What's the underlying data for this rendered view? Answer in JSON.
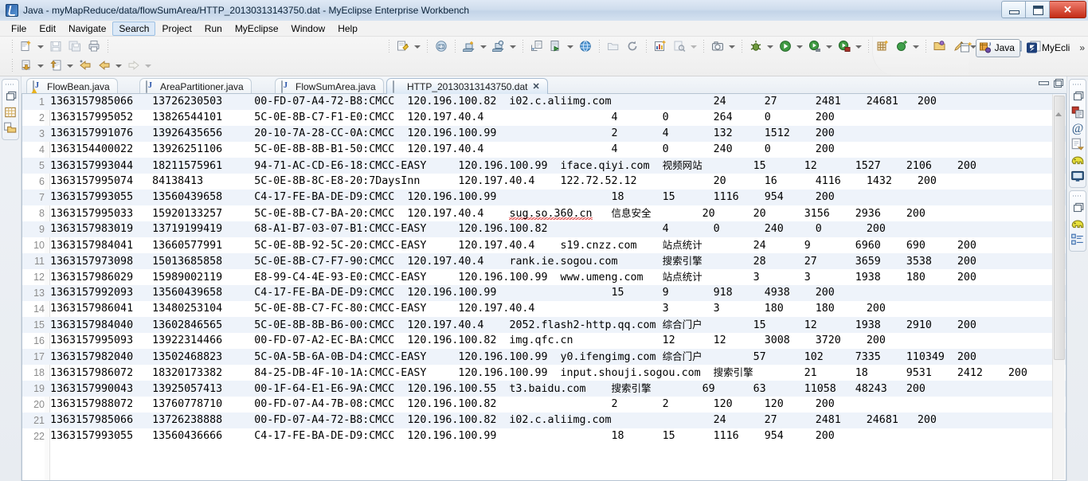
{
  "window": {
    "title": "Java - myMapReduce/data/flowSumArea/HTTP_20130313143750.dat - MyEclipse Enterprise Workbench",
    "app_icon": "myeclipse-icon",
    "controls": [
      {
        "name": "minimize-button",
        "glyph": "minimize-icon"
      },
      {
        "name": "restore-button",
        "glyph": "restore-icon"
      },
      {
        "name": "close-button",
        "glyph": "close-icon"
      }
    ]
  },
  "menubar": {
    "items": [
      {
        "label": "File",
        "selected": false
      },
      {
        "label": "Edit",
        "selected": false
      },
      {
        "label": "Navigate",
        "selected": false
      },
      {
        "label": "Search",
        "selected": true
      },
      {
        "label": "Project",
        "selected": false
      },
      {
        "label": "Run",
        "selected": false
      },
      {
        "label": "MyEclipse",
        "selected": false
      },
      {
        "label": "Window",
        "selected": false
      },
      {
        "label": "Help",
        "selected": false
      }
    ]
  },
  "toolbar": {
    "row1": [
      {
        "name": "new-wizard-button",
        "icon": "new-file-icon",
        "dropdown": true
      },
      {
        "name": "save-button",
        "icon": "save-disk-icon",
        "dropdown": false,
        "disabled": true
      },
      {
        "name": "save-all-button",
        "icon": "save-all-icon",
        "dropdown": false,
        "disabled": true
      },
      {
        "name": "print-button",
        "icon": "printer-icon",
        "dropdown": false
      },
      {
        "name": "deploy-button",
        "icon": "deploy-icon",
        "dropdown": true
      },
      {
        "name": "web-browser-button",
        "icon": "browser-2.0-icon",
        "dropdown": false
      },
      {
        "name": "new-server-button",
        "icon": "server-add-icon",
        "dropdown": true
      },
      {
        "name": "manage-server-button",
        "icon": "server-manage-icon",
        "dropdown": true
      },
      {
        "name": "import-button",
        "icon": "import-icon",
        "dropdown": false
      },
      {
        "name": "export-run-button",
        "icon": "export-run-icon",
        "dropdown": true
      },
      {
        "name": "open-browser-button",
        "icon": "globe-icon",
        "dropdown": false
      },
      {
        "name": "open-type-button",
        "icon": "open-type-icon",
        "dropdown": false,
        "disabled": true
      },
      {
        "name": "refresh-button",
        "icon": "refresh-icon",
        "dropdown": false
      },
      {
        "name": "new-report-button",
        "icon": "report-new-icon",
        "dropdown": false
      },
      {
        "name": "search-button",
        "icon": "search-page-icon",
        "dropdown": true,
        "disabled": true
      },
      {
        "name": "snapshot-button",
        "icon": "camera-icon",
        "dropdown": true
      },
      {
        "name": "debug-button",
        "icon": "debug-bug-icon",
        "dropdown": true
      },
      {
        "name": "run-button",
        "icon": "run-play-icon",
        "dropdown": true
      },
      {
        "name": "run-history-button",
        "icon": "run-history-icon",
        "dropdown": true
      },
      {
        "name": "run-external-button",
        "icon": "run-external-icon",
        "dropdown": true
      },
      {
        "name": "new-java-package-button",
        "icon": "package-new-icon",
        "dropdown": false
      },
      {
        "name": "new-class-button",
        "icon": "class-new-icon",
        "dropdown": true
      },
      {
        "name": "open-folder-button",
        "icon": "folder-open-icon",
        "dropdown": false
      },
      {
        "name": "attach-button",
        "icon": "pin-icon",
        "dropdown": true
      },
      {
        "name": "folder-yellow-button",
        "icon": "folder-yellow-icon",
        "dropdown": false
      },
      {
        "name": "toggle-block-selection-button",
        "icon": "block-selection-icon",
        "dropdown": false
      },
      {
        "name": "show-whitespace-button",
        "icon": "pilcrow-icon",
        "dropdown": false
      }
    ],
    "row2": [
      {
        "name": "import-project-button",
        "icon": "import-arrow-icon",
        "dropdown": true
      },
      {
        "name": "export-project-button",
        "icon": "export-arrow-icon",
        "dropdown": true
      },
      {
        "name": "back-history-button",
        "icon": "back-star-icon",
        "dropdown": false
      },
      {
        "name": "back-button",
        "icon": "back-arrow-icon",
        "dropdown": true
      },
      {
        "name": "forward-button",
        "icon": "forward-arrow-icon",
        "dropdown": true,
        "disabled": true
      }
    ],
    "perspective": {
      "open_perspective_name": "open-perspective-button",
      "buttons": [
        {
          "name": "perspective-java",
          "label": "Java",
          "active": true,
          "icon": "java-perspective-icon"
        },
        {
          "name": "perspective-myeclipse",
          "label": "MyEcli",
          "active": false,
          "icon": "myeclipse-perspective-icon"
        }
      ],
      "overflow": "»"
    }
  },
  "left_sidebar": {
    "group": {
      "restore_icon": "restore-view-icon",
      "items": [
        {
          "name": "package-explorer-view-icon",
          "icon": "package-explorer-icon"
        },
        {
          "name": "navigator-view-icon",
          "icon": "navigator-folder-icon"
        }
      ]
    }
  },
  "right_sidebar": {
    "groups": [
      {
        "restore_icon": "restore-view-icon",
        "items": [
          {
            "name": "db-browser-view-icon",
            "icon": "db-browser-icon"
          },
          {
            "name": "mail-view-icon",
            "icon": "at-sign-icon"
          },
          {
            "name": "snippets-view-icon",
            "icon": "snippets-icon"
          },
          {
            "name": "hadoop-view-icon",
            "icon": "elephant-icon"
          },
          {
            "name": "console-view-icon",
            "icon": "console-monitor-icon"
          }
        ]
      },
      {
        "restore_icon": "restore-view-icon",
        "items": [
          {
            "name": "hadoop-location-view-icon",
            "icon": "elephant-icon"
          },
          {
            "name": "outline-view-icon",
            "icon": "outline-icon"
          }
        ]
      }
    ]
  },
  "editor": {
    "tabs": [
      {
        "label": "FlowBean.java",
        "icon": "java-file-warning-icon",
        "active": false,
        "closable": false
      },
      {
        "label": "AreaPartitioner.java",
        "icon": "java-file-icon",
        "active": false,
        "closable": false
      },
      {
        "label": "FlowSumArea.java",
        "icon": "java-file-icon",
        "active": false,
        "closable": false
      },
      {
        "label": "HTTP_20130313143750.dat",
        "icon": "text-file-icon",
        "active": true,
        "closable": true
      }
    ],
    "close_glyph": "✕",
    "controls": [
      {
        "name": "editor-minimize-button",
        "icon": "minimize-view-icon"
      },
      {
        "name": "editor-maximize-button",
        "icon": "maximize-view-icon"
      }
    ],
    "scrollbar": {
      "name": "vertical-scrollbar",
      "thumb_name": "scrollbar-thumb"
    },
    "lines": [
      {
        "n": 1,
        "highlight": true,
        "text": "1363157985066 \t13726230503\t00-FD-07-A4-72-B8:CMCC\t120.196.100.82\ti02.c.aliimg.com\t\t24\t27\t2481\t24681\t200"
      },
      {
        "n": 2,
        "highlight": false,
        "text": "1363157995052 \t13826544101\t5C-0E-8B-C7-F1-E0:CMCC\t120.197.40.4\t\t\t4\t0\t264\t0\t200"
      },
      {
        "n": 3,
        "highlight": true,
        "text": "1363157991076 \t13926435656\t20-10-7A-28-CC-0A:CMCC\t120.196.100.99\t\t\t2\t4\t132\t1512\t200"
      },
      {
        "n": 4,
        "highlight": false,
        "text": "1363154400022 \t13926251106\t5C-0E-8B-8B-B1-50:CMCC\t120.197.40.4\t\t\t4\t0\t240\t0\t200"
      },
      {
        "n": 5,
        "highlight": true,
        "text": "1363157993044 \t18211575961\t94-71-AC-CD-E6-18:CMCC-EASY\t120.196.100.99\tiface.qiyi.com\t视频网站\t15\t12\t1527\t2106\t200"
      },
      {
        "n": 6,
        "highlight": false,
        "text": "1363157995074 \t84138413\t5C-0E-8B-8C-E8-20:7DaysInn\t120.197.40.4\t122.72.52.12\t\t20\t16\t4116\t1432\t200"
      },
      {
        "n": 7,
        "highlight": true,
        "text": "1363157993055 \t13560439658\tC4-17-FE-BA-DE-D9:CMCC\t120.196.100.99\t\t\t18\t15\t1116\t954\t200"
      },
      {
        "n": 8,
        "highlight": false,
        "text": "1363157995033 \t15920133257\t5C-0E-8B-C7-BA-20:CMCC\t120.197.40.4\tsug.so.360.cn\t信息安全\t20\t20\t3156\t2936\t200",
        "error_token": "sug.so.360.cn"
      },
      {
        "n": 9,
        "highlight": true,
        "text": "1363157983019 \t13719199419\t68-A1-B7-03-07-B1:CMCC-EASY\t120.196.100.82\t\t\t4\t0\t240\t0\t200"
      },
      {
        "n": 10,
        "highlight": false,
        "text": "1363157984041 \t13660577991\t5C-0E-8B-92-5C-20:CMCC-EASY\t120.197.40.4\ts19.cnzz.com\t站点统计\t24\t9\t6960\t690\t200"
      },
      {
        "n": 11,
        "highlight": true,
        "text": "1363157973098 \t15013685858\t5C-0E-8B-C7-F7-90:CMCC\t120.197.40.4\trank.ie.sogou.com\t搜索引擎\t28\t27\t3659\t3538\t200"
      },
      {
        "n": 12,
        "highlight": false,
        "text": "1363157986029 \t15989002119\tE8-99-C4-4E-93-E0:CMCC-EASY\t120.196.100.99\twww.umeng.com\t站点统计\t3\t3\t1938\t180\t200"
      },
      {
        "n": 13,
        "highlight": true,
        "text": "1363157992093 \t13560439658\tC4-17-FE-BA-DE-D9:CMCC\t120.196.100.99\t\t\t15\t9\t918\t4938\t200"
      },
      {
        "n": 14,
        "highlight": false,
        "text": "1363157986041 \t13480253104\t5C-0E-8B-C7-FC-80:CMCC-EASY\t120.197.40.4\t\t\t3\t3\t180\t180\t200"
      },
      {
        "n": 15,
        "highlight": true,
        "text": "1363157984040 \t13602846565\t5C-0E-8B-8B-B6-00:CMCC\t120.197.40.4\t2052.flash2-http.qq.com\t综合门户\t15\t12\t1938\t2910\t200"
      },
      {
        "n": 16,
        "highlight": false,
        "text": "1363157995093 \t13922314466\t00-FD-07-A2-EC-BA:CMCC\t120.196.100.82\timg.qfc.cn\t\t12\t12\t3008\t3720\t200"
      },
      {
        "n": 17,
        "highlight": true,
        "text": "1363157982040 \t13502468823\t5C-0A-5B-6A-0B-D4:CMCC-EASY\t120.196.100.99\ty0.ifengimg.com\t综合门户\t57\t102\t7335\t110349\t200"
      },
      {
        "n": 18,
        "highlight": false,
        "text": "1363157986072 \t18320173382\t84-25-DB-4F-10-1A:CMCC-EASY\t120.196.100.99\tinput.shouji.sogou.com\t搜索引擎\t21\t18\t9531\t2412\t200"
      },
      {
        "n": 19,
        "highlight": true,
        "text": "1363157990043 \t13925057413\t00-1F-64-E1-E6-9A:CMCC\t120.196.100.55\tt3.baidu.com\t搜索引擎\t69\t63\t11058\t48243\t200"
      },
      {
        "n": 20,
        "highlight": false,
        "text": "1363157988072 \t13760778710\t00-FD-07-A4-7B-08:CMCC\t120.196.100.82\t\t\t2\t2\t120\t120\t200"
      },
      {
        "n": 21,
        "highlight": true,
        "text": "1363157985066 \t13726238888\t00-FD-07-A4-72-B8:CMCC\t120.196.100.82\ti02.c.aliimg.com\t\t24\t27\t2481\t24681\t200"
      },
      {
        "n": 22,
        "highlight": false,
        "text": "1363157993055 \t13560436666\tC4-17-FE-BA-DE-D9:CMCC\t120.196.100.99\t\t\t18\t15\t1116\t954\t200"
      }
    ]
  },
  "colors": {
    "title_bar": "#cfdded",
    "close_button": "#c32b16",
    "active_tab": "#dbe8f5",
    "line_highlight": "#eef3fa",
    "gutter_text": "#8c8c8c",
    "error_squiggle": "#dd3333"
  }
}
